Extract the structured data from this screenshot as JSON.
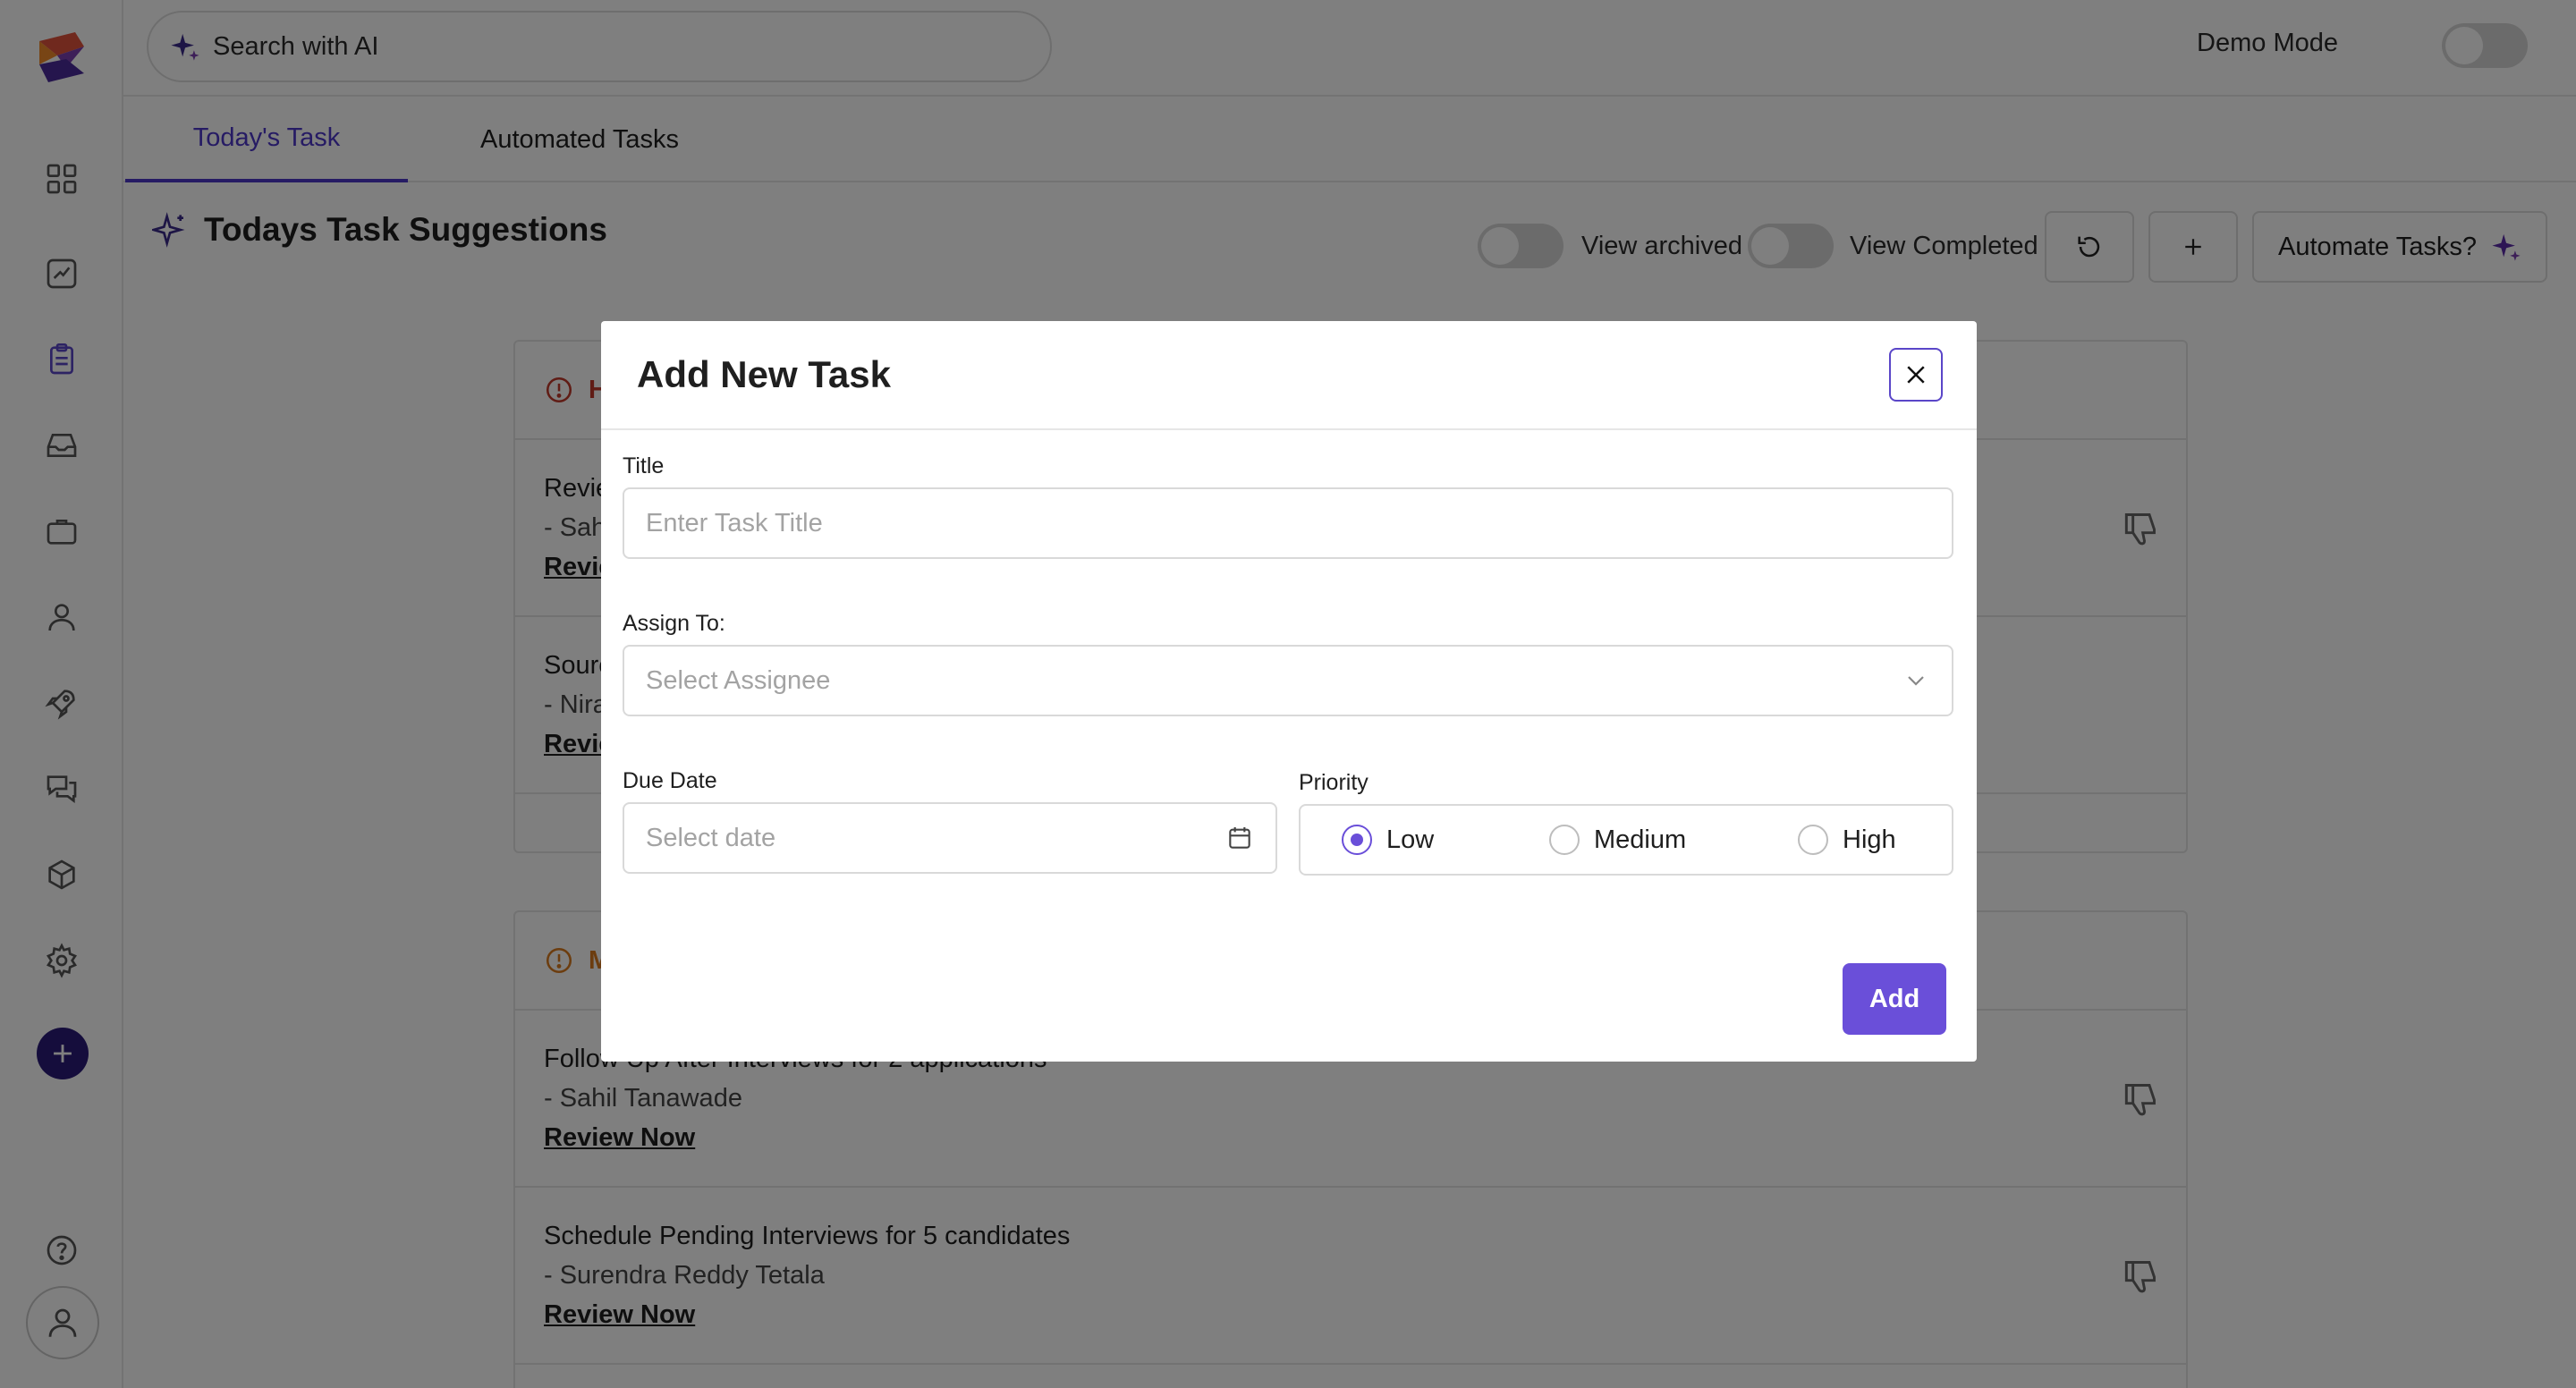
{
  "app": {
    "search": {
      "placeholder": "Search with AI"
    },
    "demo_mode": {
      "label": "Demo Mode",
      "enabled": false
    }
  },
  "sidebar": {
    "items": [
      {
        "icon": "grid-icon"
      },
      {
        "icon": "chart-icon"
      },
      {
        "icon": "clipboard-icon"
      },
      {
        "icon": "inbox-icon"
      },
      {
        "icon": "briefcase-icon"
      },
      {
        "icon": "user-icon"
      },
      {
        "icon": "rocket-icon"
      },
      {
        "icon": "chat-icon"
      },
      {
        "icon": "cube-icon"
      },
      {
        "icon": "gear-icon"
      },
      {
        "icon": "plus-circle-icon"
      },
      {
        "icon": "help-icon"
      },
      {
        "icon": "profile-icon"
      }
    ]
  },
  "tabs": [
    {
      "label": "Today's Task",
      "active": true
    },
    {
      "label": "Automated Tasks",
      "active": false
    }
  ],
  "section": {
    "title": "Todays Task Suggestions",
    "view_archived_label": "View archived",
    "view_completed_label": "View Completed",
    "automate_label": "Automate Tasks?"
  },
  "cards": [
    {
      "heading": "H",
      "color": "#c0392b",
      "rows": [
        {
          "title": "Revie",
          "sub": "- Sah",
          "link": "Revie"
        },
        {
          "title": "Sourc",
          "sub": "- Nira",
          "link": "Revie"
        }
      ]
    },
    {
      "heading": "M",
      "color": "#d97a1e",
      "rows": [
        {
          "title": "Follow Up After Interviews for 2 applications",
          "sub": "- Sahil Tanawade",
          "link": "Review Now"
        },
        {
          "title": "Schedule Pending Interviews for 5 candidates",
          "sub": "- Surendra Reddy Tetala",
          "link": "Review Now"
        }
      ]
    }
  ],
  "modal": {
    "title": "Add New Task",
    "title_label": "Title",
    "title_placeholder": "Enter Task Title",
    "assign_label": "Assign To:",
    "assign_placeholder": "Select Assignee",
    "due_label": "Due Date",
    "due_placeholder": "Select date",
    "priority_label": "Priority",
    "priority_options": [
      "Low",
      "Medium",
      "High"
    ],
    "priority_selected": "Low",
    "submit_label": "Add"
  },
  "colors": {
    "accent": "#6a4fd9",
    "tab_active": "#4d37c9",
    "nav_add": "#2a1a78"
  }
}
